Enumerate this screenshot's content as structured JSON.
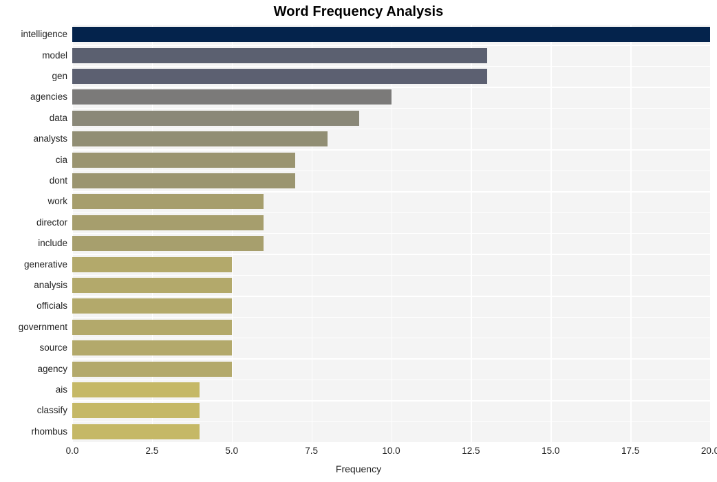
{
  "chart_data": {
    "type": "bar",
    "orientation": "horizontal",
    "title": "Word Frequency Analysis",
    "xlabel": "Frequency",
    "ylabel": "",
    "xlim": [
      0,
      20
    ],
    "xticks": [
      "0.0",
      "2.5",
      "5.0",
      "7.5",
      "10.0",
      "12.5",
      "15.0",
      "17.5",
      "20.0"
    ],
    "xtick_values": [
      0,
      2.5,
      5,
      7.5,
      10,
      12.5,
      15,
      17.5,
      20
    ],
    "grid": true,
    "legend": "none",
    "categories": [
      "intelligence",
      "model",
      "gen",
      "agencies",
      "data",
      "analysts",
      "cia",
      "dont",
      "work",
      "director",
      "include",
      "generative",
      "analysis",
      "officials",
      "government",
      "source",
      "agency",
      "ais",
      "classify",
      "rhombus"
    ],
    "values": [
      20,
      13,
      13,
      10,
      9,
      8,
      7,
      7,
      6,
      6,
      6,
      5,
      5,
      5,
      5,
      5,
      5,
      4,
      4,
      4
    ],
    "bar_colors": [
      "#04234c",
      "#5b6070",
      "#5c6071",
      "#7b7a79",
      "#8a8878",
      "#918e74",
      "#9a9470",
      "#9b9570",
      "#a69e6d",
      "#a69e6d",
      "#a79f6d",
      "#b3a96b",
      "#b3a96b",
      "#b3a96b",
      "#b3a96b",
      "#b3a96b",
      "#b3a96b",
      "#c5b866",
      "#c5b866",
      "#c5b866"
    ],
    "plot_background": "#f4f4f4",
    "gridline_color": "#ffffff",
    "figure_background": "#ffffff",
    "title_color": "#000000"
  }
}
